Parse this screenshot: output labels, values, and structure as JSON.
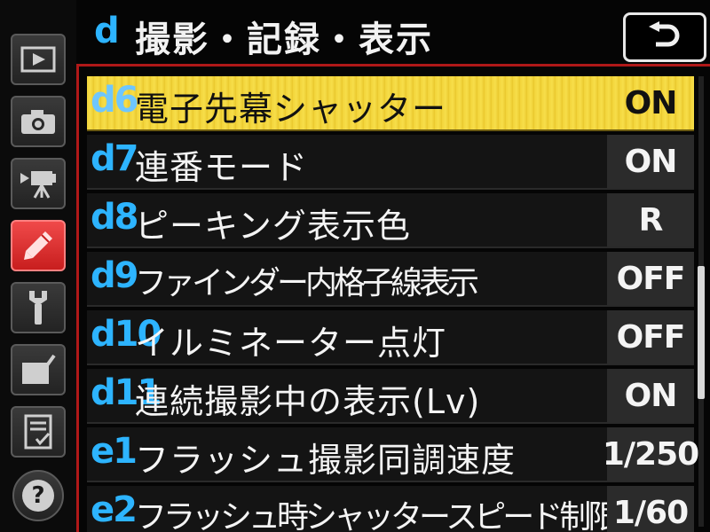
{
  "header": {
    "group_letter": "d",
    "title": "撮影・記録・表示",
    "back_icon": "return-arrow-icon"
  },
  "sidebar": {
    "tabs": [
      {
        "name": "playback-menu",
        "icon": "play-icon",
        "active": false
      },
      {
        "name": "photo-shooting-menu",
        "icon": "camera-icon",
        "active": false
      },
      {
        "name": "movie-shooting-menu",
        "icon": "movie-camera-icon",
        "active": false
      },
      {
        "name": "custom-settings-menu",
        "icon": "pencil-icon",
        "active": true
      },
      {
        "name": "setup-menu",
        "icon": "wrench-icon",
        "active": false
      },
      {
        "name": "retouch-menu",
        "icon": "retouch-brush-icon",
        "active": false
      },
      {
        "name": "my-menu",
        "icon": "checklist-icon",
        "active": false
      },
      {
        "name": "help",
        "icon": "help-icon",
        "active": false
      }
    ]
  },
  "menu": {
    "items": [
      {
        "code": "d6",
        "label": "電子先幕シャッター",
        "value": "ON",
        "selected": true
      },
      {
        "code": "d7",
        "label": "連番モード",
        "value": "ON",
        "selected": false
      },
      {
        "code": "d8",
        "label": "ピーキング表示色",
        "value": "R",
        "selected": false
      },
      {
        "code": "d9",
        "label": "ファインダー内格子線表示",
        "value": "OFF",
        "selected": false
      },
      {
        "code": "d10",
        "label": "イルミネーター点灯",
        "value": "OFF",
        "selected": false
      },
      {
        "code": "d11",
        "label": "連続撮影中の表示(Lv)",
        "value": "ON",
        "selected": false
      },
      {
        "code": "e1",
        "label": "フラッシュ撮影同調速度",
        "value": "1/250",
        "selected": false
      },
      {
        "code": "e2",
        "label": "フラッシュ時シャッタースピード制限",
        "value": "1/60",
        "selected": false
      }
    ]
  },
  "colors": {
    "accent_blue": "#2db4ff",
    "selection_yellow": "#f2d43a",
    "active_tab_red": "#d82828",
    "frame_red": "#b01818"
  }
}
